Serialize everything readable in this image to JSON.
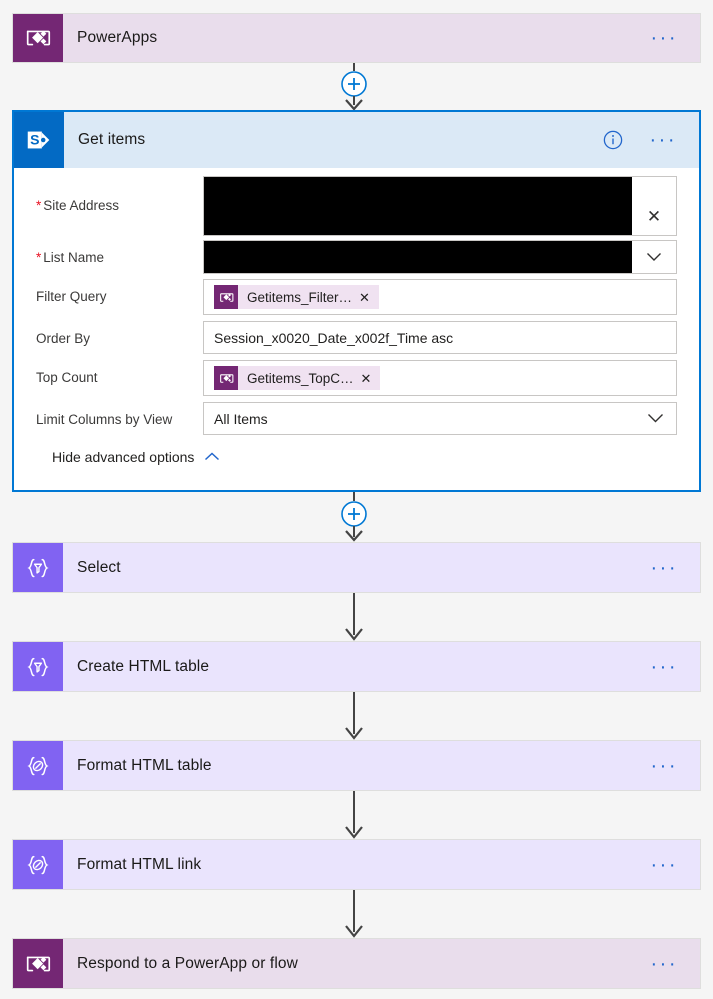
{
  "flow": {
    "steps": [
      {
        "name": "powerapps-trigger",
        "title": "PowerApps",
        "icon": "powerapps-icon",
        "type": "powerapps",
        "ellipsis": "···"
      },
      {
        "name": "get-items",
        "title": "Get items",
        "icon": "sharepoint-icon",
        "type": "sharepoint-expanded",
        "info_icon": "info-icon",
        "ellipsis": "···"
      },
      {
        "name": "select",
        "title": "Select",
        "icon": "data-operation-filter-icon",
        "type": "dataop",
        "ellipsis": "···"
      },
      {
        "name": "create-html-table",
        "title": "Create HTML table",
        "icon": "data-operation-filter-icon",
        "type": "dataop",
        "ellipsis": "···"
      },
      {
        "name": "format-html-table",
        "title": "Format HTML table",
        "icon": "data-operation-compose-icon",
        "type": "dataop",
        "ellipsis": "···"
      },
      {
        "name": "format-html-link",
        "title": "Format HTML link",
        "icon": "data-operation-compose-icon",
        "type": "dataop",
        "ellipsis": "···"
      },
      {
        "name": "respond-to-powerapp",
        "title": "Respond to a PowerApp or flow",
        "icon": "powerapps-icon",
        "type": "powerapps",
        "ellipsis": "···"
      }
    ]
  },
  "get_items": {
    "title": "Get items",
    "fields": {
      "site_address": {
        "label": "Site Address",
        "required_marker": "*",
        "value": "",
        "redacted": true,
        "clear_icon": "✕"
      },
      "list_name": {
        "label": "List Name",
        "required_marker": "*",
        "value": "",
        "redacted": true,
        "chevron_icon": "∨"
      },
      "filter_query": {
        "label": "Filter Query",
        "token_label": "Getitems_Filter…",
        "token_remove": "✕"
      },
      "order_by": {
        "label": "Order By",
        "value": "Session_x0020_Date_x002f_Time asc"
      },
      "top_count": {
        "label": "Top Count",
        "token_label": "Getitems_TopC…",
        "token_remove": "✕"
      },
      "limit_columns_by_view": {
        "label": "Limit Columns by View",
        "value": "All Items",
        "chevron_icon": "∨"
      }
    },
    "advanced_options": {
      "label": "Hide advanced options",
      "chevron_icon": "chevron-up-icon"
    }
  },
  "connectors": {
    "insert_button_label": "+"
  },
  "colors": {
    "powerapps_purple": "#742774",
    "powerapps_card_bg": "#e9ddec",
    "dataop_violet": "#8163f2",
    "dataop_card_bg": "#eae4fd",
    "sharepoint_blue": "#036ac4",
    "selected_border": "#0078d4",
    "header_bg": "#dbe9f6",
    "accent_link": "#2266cc",
    "required_red": "#e81123",
    "canvas_bg": "#f5f5f5"
  }
}
